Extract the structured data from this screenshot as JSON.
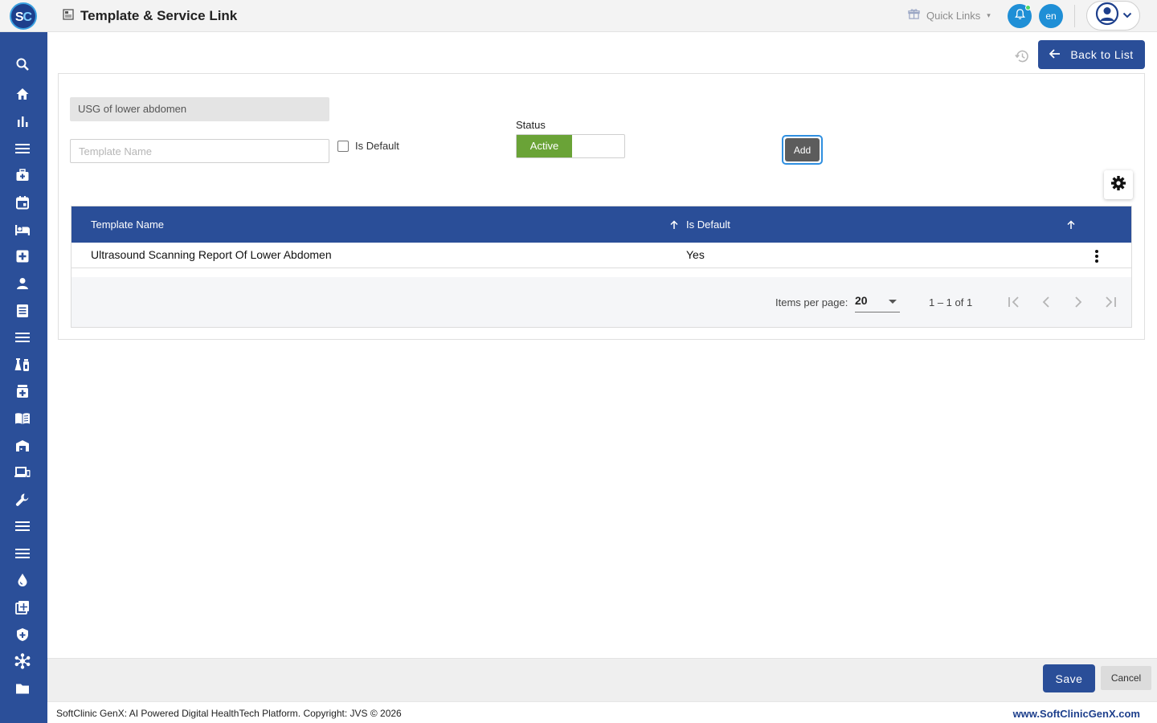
{
  "app": {
    "logo_letters": {
      "s": "S",
      "c": "C"
    },
    "page_title": "Template & Service Link"
  },
  "header": {
    "quick_links_label": "Quick Links",
    "language": "en"
  },
  "toolbar": {
    "back_label": "Back to List"
  },
  "form": {
    "service_value": "USG of lower abdomen",
    "template_placeholder": "Template Name",
    "is_default_label": "Is Default",
    "is_default_checked": false,
    "status_label": "Status",
    "status_active_label": "Active",
    "add_label": "Add"
  },
  "table": {
    "columns": [
      "Template Name",
      "Is Default"
    ],
    "rows": [
      {
        "template_name": "Ultrasound Scanning Report Of Lower Abdomen",
        "is_default": "Yes"
      }
    ],
    "paginator": {
      "items_per_page_label": "Items per page:",
      "items_per_page": "20",
      "range_label": "1 – 1 of 1"
    }
  },
  "actions": {
    "save_label": "Save",
    "cancel_label": "Cancel"
  },
  "footer": {
    "copyright": "SoftClinic GenX: AI Powered Digital HealthTech Platform. Copyright: JVS © 2026",
    "website": "www.SoftClinicGenX.com"
  },
  "colors": {
    "primary": "#2a4e98",
    "active_green": "#6aa337",
    "accent_blue": "#1f8fd6"
  },
  "sidebar_icons": [
    "search-icon",
    "home-icon",
    "bar-chart-icon",
    "menu-icon",
    "medical-bag-icon",
    "calendar-icon",
    "bed-icon",
    "medical-plus-icon",
    "person-icon",
    "document-list-icon",
    "menu-icon",
    "lab-icon",
    "pharmacy-icon",
    "book-icon",
    "warehouse-icon",
    "devices-icon",
    "wrench-icon",
    "menu-icon",
    "menu-icon",
    "blood-drop-icon",
    "add-box-icon",
    "shield-icon",
    "hub-icon",
    "folder-icon"
  ]
}
